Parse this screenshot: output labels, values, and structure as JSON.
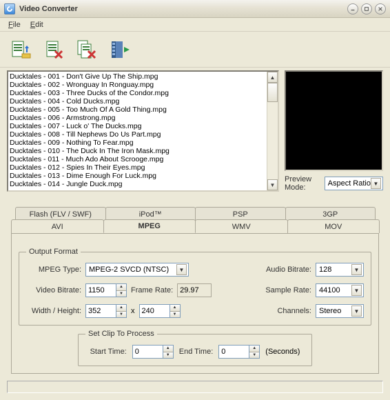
{
  "window": {
    "title": "Video Converter"
  },
  "menu": {
    "file": "File",
    "edit": "Edit"
  },
  "files": [
    "Ducktales - 001 - Don't Give Up The Ship.mpg",
    "Ducktales - 002 - Wronguay In Ronguay.mpg",
    "Ducktales - 003 - Three Ducks of the Condor.mpg",
    "Ducktales - 004 - Cold Ducks.mpg",
    "Ducktales - 005 - Too Much Of A Gold Thing.mpg",
    "Ducktales - 006 - Armstrong.mpg",
    "Ducktales - 007 - Luck o' The Ducks.mpg",
    "Ducktales - 008 - Till Nephews Do Us Part.mpg",
    "Ducktales - 009 - Nothing To Fear.mpg",
    "Ducktales - 010 - The Duck In The Iron Mask.mpg",
    "Ducktales - 011 - Much Ado About Scrooge.mpg",
    "Ducktales - 012 - Spies In Their Eyes.mpg",
    "Ducktales - 013 - Dime Enough For Luck.mpg",
    "Ducktales - 014 - Jungle Duck.mpg"
  ],
  "preview": {
    "label": "Preview Mode:",
    "mode": "Aspect Ratio"
  },
  "tabs": {
    "back": [
      "Flash (FLV / SWF)",
      "iPod™",
      "PSP",
      "3GP"
    ],
    "front": [
      "AVI",
      "MPEG",
      "WMV",
      "MOV"
    ],
    "active": "MPEG"
  },
  "output": {
    "legend": "Output Format",
    "mpeg_type_label": "MPEG Type:",
    "mpeg_type": "MPEG-2 SVCD (NTSC)",
    "video_bitrate_label": "Video Bitrate:",
    "video_bitrate": "1150",
    "frame_rate_label": "Frame Rate:",
    "frame_rate": "29.97",
    "wh_label": "Width / Height:",
    "width": "352",
    "height": "240",
    "x": "x",
    "audio_bitrate_label": "Audio Bitrate:",
    "audio_bitrate": "128",
    "sample_rate_label": "Sample Rate:",
    "sample_rate": "44100",
    "channels_label": "Channels:",
    "channels": "Stereo"
  },
  "clip": {
    "legend": "Set Clip To Process",
    "start_label": "Start Time:",
    "start": "0",
    "end_label": "End Time:",
    "end": "0",
    "seconds": "(Seconds)"
  }
}
